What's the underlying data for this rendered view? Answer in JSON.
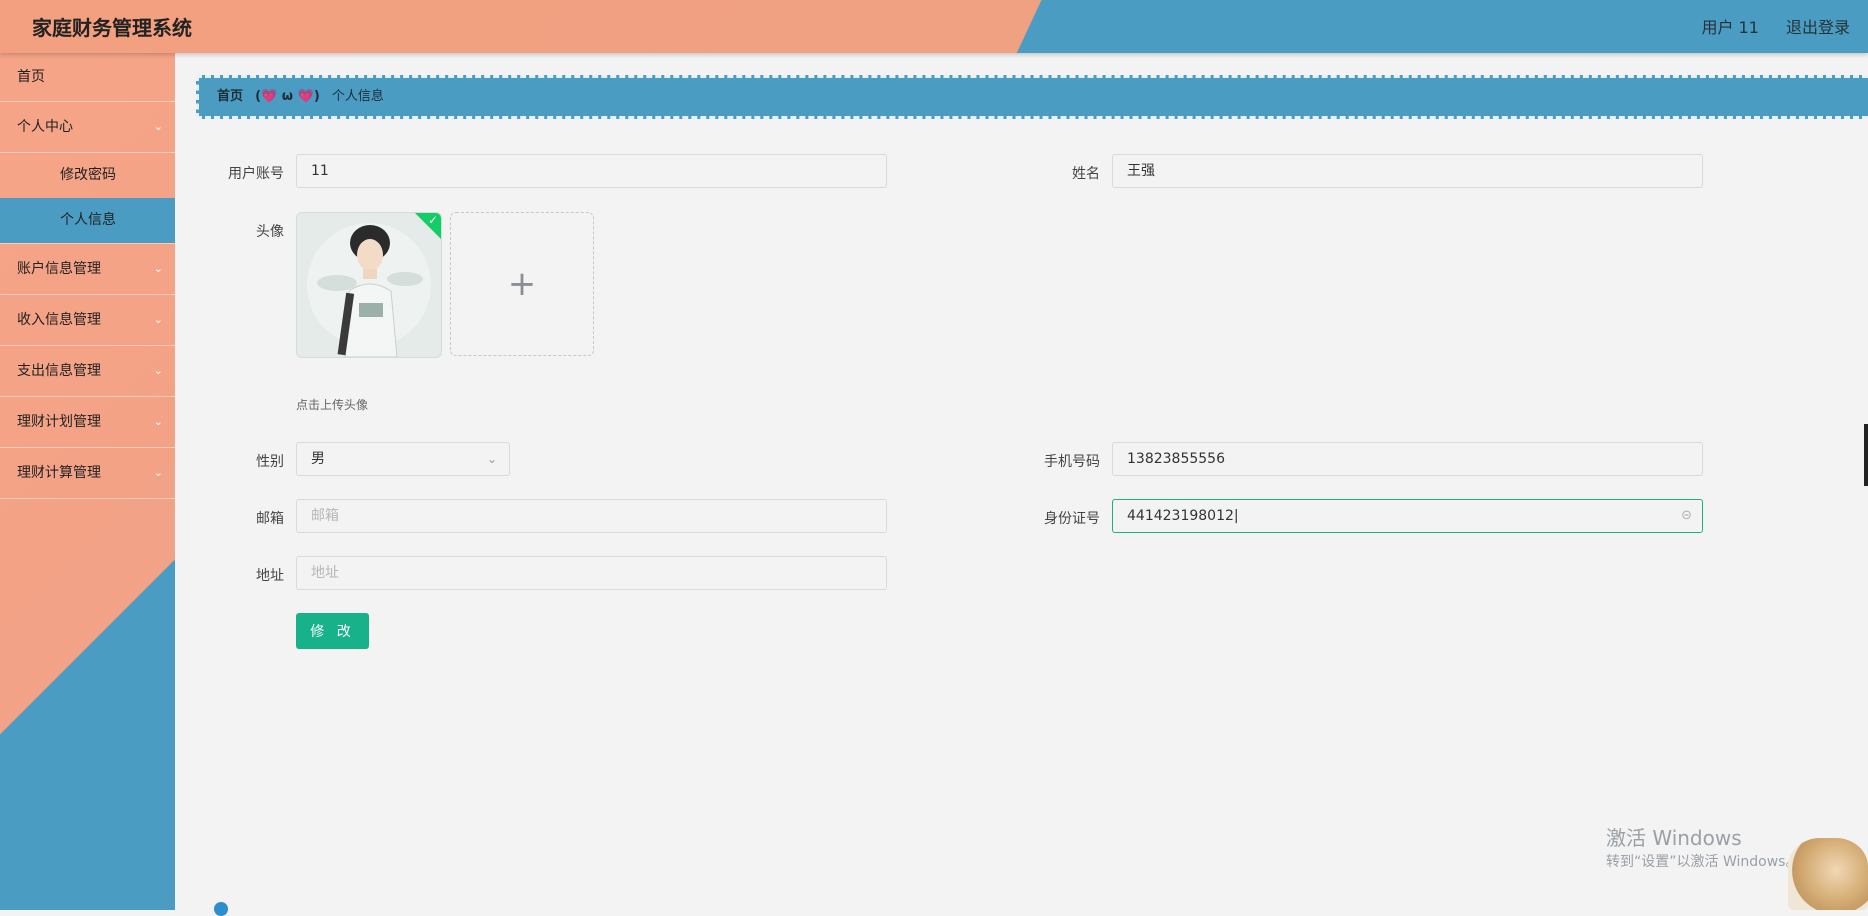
{
  "app": {
    "title": "家庭财务管理系统"
  },
  "header": {
    "user_label": "用户 11",
    "logout_label": "退出登录"
  },
  "sidebar": {
    "items": [
      {
        "label": "首页"
      },
      {
        "label": "个人中心",
        "children": [
          {
            "label": "修改密码"
          },
          {
            "label": "个人信息",
            "active": true
          }
        ]
      },
      {
        "label": "账户信息管理"
      },
      {
        "label": "收入信息管理"
      },
      {
        "label": "支出信息管理"
      },
      {
        "label": "理财计划管理"
      },
      {
        "label": "理财计算管理"
      }
    ],
    "chevron": "chevron-down-icon"
  },
  "breadcrumb": {
    "home": "首页",
    "separator": "(💗 ω 💗)",
    "current": "个人信息"
  },
  "form": {
    "account": {
      "label": "用户账号",
      "value": "11"
    },
    "name": {
      "label": "姓名",
      "value": "王强"
    },
    "avatar": {
      "label": "头像",
      "hint": "点击上传头像",
      "upload_symbol": "+"
    },
    "gender": {
      "label": "性别",
      "value": "男"
    },
    "phone": {
      "label": "手机号码",
      "value": "13823855556"
    },
    "email": {
      "label": "邮箱",
      "placeholder": "邮箱"
    },
    "idcard": {
      "label": "身份证号",
      "value": "441423198012"
    },
    "address": {
      "label": "地址",
      "placeholder": "地址"
    },
    "submit": "修 改"
  },
  "watermark": {
    "line1": "激活 Windows",
    "line2": "转到“设置”以激活 Windows。"
  },
  "colors": {
    "header_left": "#f2a07f",
    "header_right": "#4a9cc3",
    "accent": "#17b28a",
    "success": "#13ce66"
  }
}
